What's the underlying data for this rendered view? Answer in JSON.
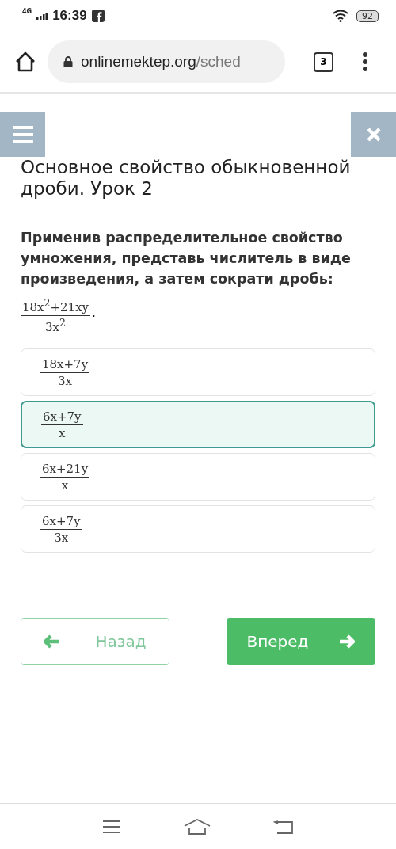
{
  "status_bar": {
    "network": "4G",
    "time": "16:39",
    "battery": "92"
  },
  "browser": {
    "url_host": "onlinemektep.org",
    "url_path": "/sched",
    "tab_count": "3"
  },
  "lesson_title": "Основное свойство обыкновенной дроби. Урок 2",
  "question": {
    "text": "Применив распределительное свойство умножения, представь числитель в виде произведения, а затем сократи дробь:",
    "numerator": "18x$^{2}$+21xy",
    "denominator": "3x$^{2}$",
    "trailing": "."
  },
  "options": [
    {
      "numerator": "18x+7y",
      "denominator": "3x",
      "selected": false
    },
    {
      "numerator": "6x+7y",
      "denominator": "x",
      "selected": true
    },
    {
      "numerator": "6x+21y",
      "denominator": "x",
      "selected": false
    },
    {
      "numerator": "6x+7y",
      "denominator": "3x",
      "selected": false
    }
  ],
  "navigation": {
    "back": "Назад",
    "next": "Вперед"
  }
}
